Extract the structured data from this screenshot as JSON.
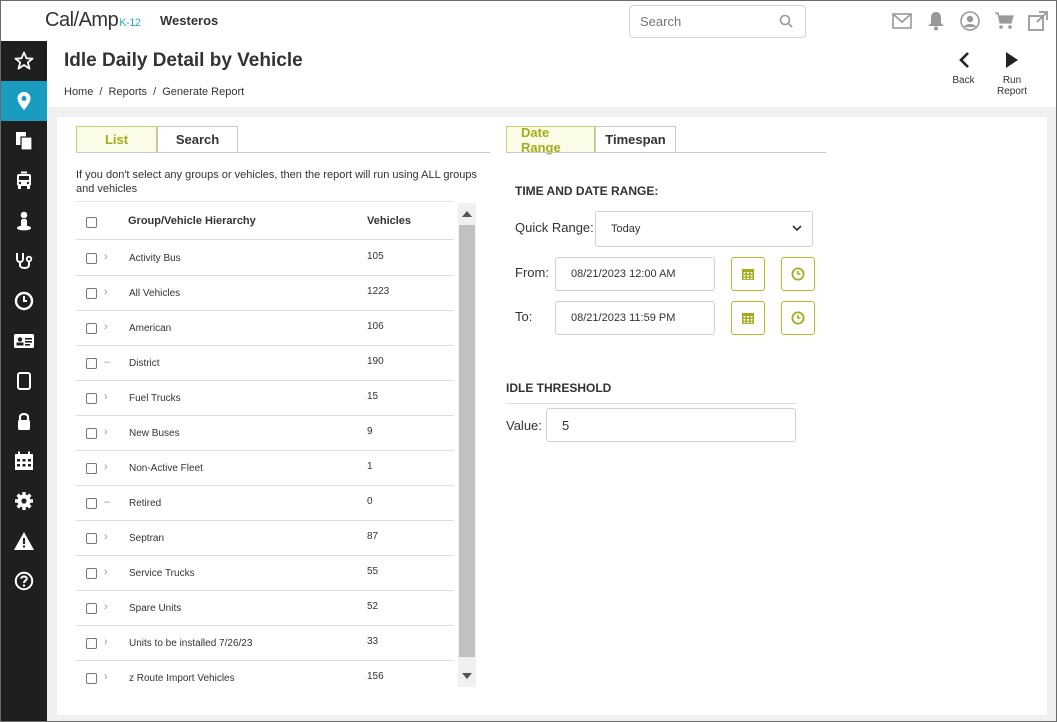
{
  "app": {
    "brand_main": "Cal/Amp",
    "brand_sub": "K-12",
    "org_name": "Westeros",
    "search_placeholder": "Search"
  },
  "top_icons": [
    "mail-icon",
    "bell-icon",
    "user-circle-icon",
    "cart-icon",
    "external-link-icon"
  ],
  "sidebar": {
    "items": [
      {
        "icon": "star-icon",
        "active": false
      },
      {
        "icon": "map-pin-icon",
        "active": true
      },
      {
        "icon": "documents-icon",
        "active": false
      },
      {
        "icon": "bus-icon",
        "active": false
      },
      {
        "icon": "driver-icon",
        "active": false
      },
      {
        "icon": "stethoscope-icon",
        "active": false
      },
      {
        "icon": "clock-icon",
        "active": false
      },
      {
        "icon": "id-card-icon",
        "active": false
      },
      {
        "icon": "tablet-icon",
        "active": false
      },
      {
        "icon": "lock-icon",
        "active": false
      },
      {
        "icon": "calendar-icon",
        "active": false
      },
      {
        "icon": "gear-icon",
        "active": false
      },
      {
        "icon": "warning-icon",
        "active": false
      },
      {
        "icon": "help-icon",
        "active": false
      }
    ]
  },
  "page": {
    "title": "Idle Daily Detail by Vehicle",
    "breadcrumb": [
      "Home",
      "/",
      "Reports",
      "/",
      "Generate Report"
    ],
    "back_label": "Back",
    "run_label": "Run Report"
  },
  "left_tabs": [
    {
      "label": "List",
      "active": true
    },
    {
      "label": "Search",
      "active": false
    }
  ],
  "hint": "If you don't select any groups or vehicles, then the report will run using ALL groups and vehicles",
  "table": {
    "col_group": "Group/Vehicle Hierarchy",
    "col_vehicles": "Vehicles",
    "rows": [
      {
        "name": "Activity Bus",
        "count": "105",
        "expander": "›"
      },
      {
        "name": "All Vehicles",
        "count": "1223",
        "expander": "›"
      },
      {
        "name": "American",
        "count": "106",
        "expander": "›"
      },
      {
        "name": "District",
        "count": "190",
        "expander": "–"
      },
      {
        "name": "Fuel Trucks",
        "count": "15",
        "expander": "›"
      },
      {
        "name": "New Buses",
        "count": "9",
        "expander": "›"
      },
      {
        "name": "Non-Active Fleet",
        "count": "1",
        "expander": "›"
      },
      {
        "name": "Retired",
        "count": "0",
        "expander": "–"
      },
      {
        "name": "Septran",
        "count": "87",
        "expander": "›"
      },
      {
        "name": "Service Trucks",
        "count": "55",
        "expander": "›"
      },
      {
        "name": "Spare Units",
        "count": "52",
        "expander": "›"
      },
      {
        "name": "Units to be installed 7/26/23",
        "count": "33",
        "expander": "›"
      },
      {
        "name": "z Route Import Vehicles",
        "count": "156",
        "expander": "›"
      }
    ]
  },
  "right_tabs": [
    {
      "label": "Date Range",
      "active": true
    },
    {
      "label": "Timespan",
      "active": false
    }
  ],
  "date_range": {
    "section_title": "TIME AND DATE RANGE:",
    "quick_range_label": "Quick Range:",
    "quick_range_value": "Today",
    "from_label": "From:",
    "from_value": "08/21/2023 12:00 AM",
    "to_label": "To:",
    "to_value": "08/21/2023 11:59 PM"
  },
  "idle": {
    "section_title": "IDLE THRESHOLD",
    "value_label": "Value:",
    "value": "5"
  },
  "colors": {
    "accent_blue": "#1a9bc0",
    "accent_olive": "#a4ac1e",
    "nav_bg": "#1f1f1f"
  }
}
